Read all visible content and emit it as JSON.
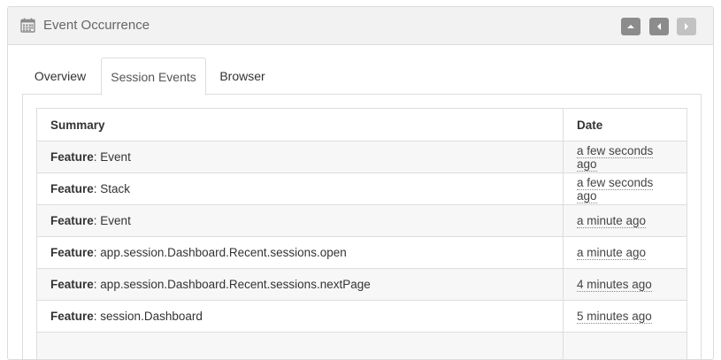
{
  "panel": {
    "title": "Event Occurrence",
    "icon": "calendar-icon",
    "buttons": [
      {
        "name": "collapse",
        "icon": "chevron-up-icon"
      },
      {
        "name": "previous",
        "icon": "chevron-left-icon"
      },
      {
        "name": "next",
        "icon": "chevron-right-icon"
      }
    ]
  },
  "tabs": [
    {
      "label": "Overview",
      "active": false
    },
    {
      "label": "Session Events",
      "active": true
    },
    {
      "label": "Browser",
      "active": false
    }
  ],
  "table": {
    "headers": {
      "summary": "Summary",
      "date": "Date"
    },
    "rows": [
      {
        "key": "Feature",
        "sep": ": ",
        "value": "Event",
        "date": "a few seconds ago"
      },
      {
        "key": "Feature",
        "sep": ": ",
        "value": "Stack",
        "date": "a few seconds ago"
      },
      {
        "key": "Feature",
        "sep": ": ",
        "value": "Event",
        "date": "a minute ago"
      },
      {
        "key": "Feature",
        "sep": ": ",
        "value": "app.session.Dashboard.Recent.sessions.open",
        "date": "a minute ago"
      },
      {
        "key": "Feature",
        "sep": ": ",
        "value": "app.session.Dashboard.Recent.sessions.nextPage",
        "date": "4 minutes ago"
      },
      {
        "key": "Feature",
        "sep": ": ",
        "value": "session.Dashboard",
        "date": "5 minutes ago"
      },
      {
        "key": "",
        "sep": "",
        "value": "",
        "date": ""
      }
    ]
  },
  "colors": {
    "header_bg": "#f2f2f2",
    "button_active": "#8c8c8c",
    "button_disabled": "#c2c2c2",
    "row_stripe": "#f7f7f7"
  }
}
